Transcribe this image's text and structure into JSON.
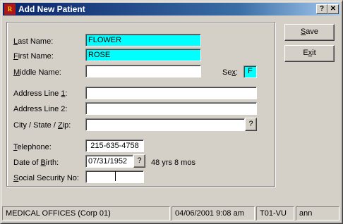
{
  "window": {
    "title": "Add New Patient",
    "help_label": "?",
    "close_label": "✕"
  },
  "form": {
    "last_name": {
      "label_u": "L",
      "label_rest": "ast Name:",
      "value": "FLOWER"
    },
    "first_name": {
      "label_u": "F",
      "label_rest": "irst Name:",
      "value": "ROSE"
    },
    "middle_name": {
      "label_u": "M",
      "label_rest": "iddle Name:",
      "value": ""
    },
    "sex": {
      "label_pre": "Se",
      "label_u": "x",
      "label_post": ":",
      "value": "F"
    },
    "address1": {
      "label_pre": "Address Line ",
      "label_u": "1",
      "label_post": ":",
      "value": ""
    },
    "address2": {
      "label": "Address Line 2:",
      "value": ""
    },
    "city_state_zip": {
      "label_pre": "City / State / ",
      "label_u": "Z",
      "label_post": "ip:",
      "value": "",
      "lookup_label": "?"
    },
    "telephone": {
      "label_u": "T",
      "label_rest": "elephone:",
      "value": "215-635-4758"
    },
    "dob": {
      "label_pre": "Date of ",
      "label_u": "B",
      "label_post": "irth:",
      "value": "07/31/1952",
      "lookup_label": "?",
      "age": "48 yrs  8 mos"
    },
    "ssn": {
      "label_u": "S",
      "label_rest": "ocial Security No:",
      "value": ""
    }
  },
  "buttons": {
    "save": {
      "label_u": "S",
      "label_rest": "ave"
    },
    "exit": {
      "label_pre": "E",
      "label_u": "x",
      "label_rest": "it"
    }
  },
  "status": {
    "office": "MEDICAL OFFICES (Corp 01)",
    "datetime": "04/06/2001  9:08 am",
    "terminal": "T01-VU",
    "user": "ann"
  },
  "colors": {
    "highlight_field": "#00ffff",
    "titlebar_start": "#0a246a",
    "face": "#d4d0c8"
  }
}
